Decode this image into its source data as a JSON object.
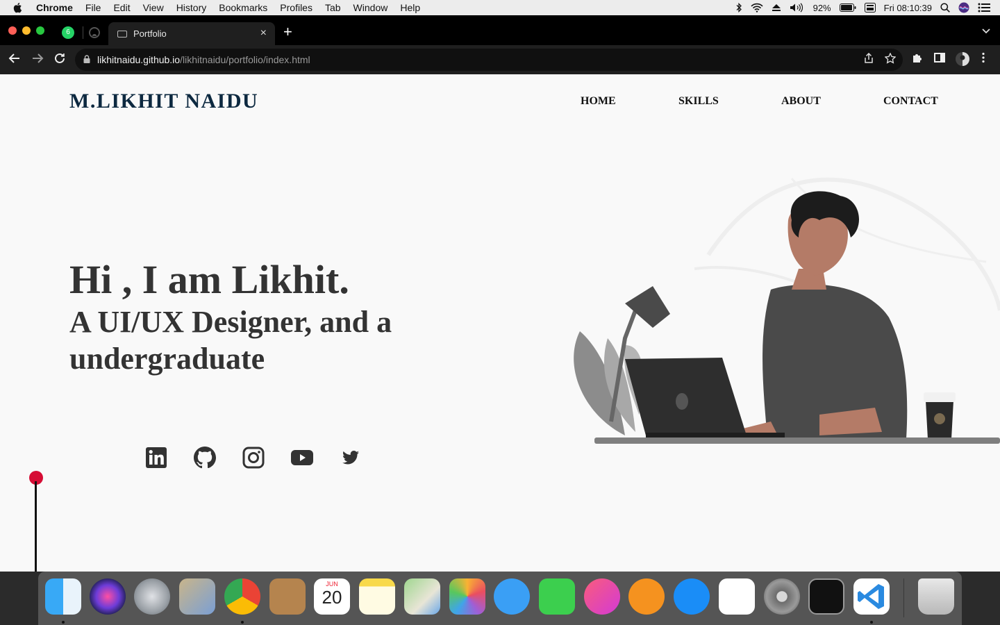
{
  "menubar": {
    "app_name": "Chrome",
    "items": [
      "File",
      "Edit",
      "View",
      "History",
      "Bookmarks",
      "Profiles",
      "Tab",
      "Window",
      "Help"
    ],
    "battery": "92%",
    "clock": "Fri 08:10:39"
  },
  "browser": {
    "tab_title": "Portfolio",
    "url_host": "likhitnaidu.github.io",
    "url_path": "/likhitnaidu/portfolio/index.html",
    "pinned_badge": "6"
  },
  "page": {
    "brand": "M.LIKHIT NAIDU",
    "nav": [
      "HOME",
      "SKILLS",
      "ABOUT",
      "CONTACT"
    ],
    "greeting": "Hi , I am Likhit.",
    "role": "A UI/UX Designer, and a undergraduate",
    "social": [
      "linkedin-icon",
      "github-icon",
      "instagram-icon",
      "youtube-icon",
      "twitter-icon"
    ]
  },
  "dock": {
    "apps": [
      "Finder",
      "Siri",
      "Launchpad",
      "Mail",
      "Google Chrome",
      "Contacts",
      "Calendar",
      "Notes",
      "Maps",
      "Photos",
      "Messages",
      "FaceTime",
      "Music",
      "Books",
      "App Store",
      "Reminders",
      "System Preferences",
      "Terminal",
      "Visual Studio Code",
      "Trash"
    ],
    "calendar_month": "JUN",
    "calendar_day": "20"
  },
  "colors": {
    "brand": "#0d2940",
    "accent_pin": "#d60d35",
    "page_bg": "#f9f9f9"
  }
}
